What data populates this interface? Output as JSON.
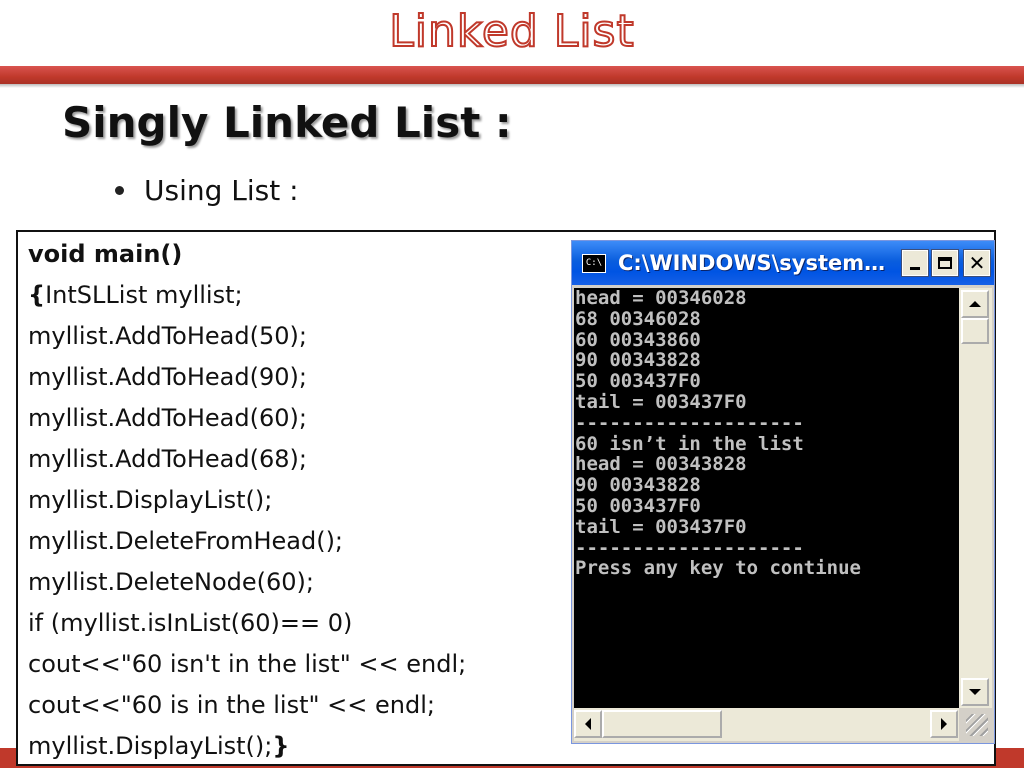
{
  "slide": {
    "title": "Linked List",
    "heading": "Singly Linked List :",
    "bullet": "Using List :"
  },
  "code": {
    "line1": "void main()",
    "line2_brace": "{",
    "line2_text": "IntSLList myllist;",
    "lines": [
      "myllist.AddToHead(50);",
      "myllist.AddToHead(90);",
      "myllist.AddToHead(60);",
      "myllist.AddToHead(68);",
      "myllist.DisplayList();",
      "myllist.DeleteFromHead();",
      "myllist.DeleteNode(60);",
      "if (myllist.isInList(60)== 0)",
      "cout<<\"60 isn't in the list\" << endl;",
      "cout<<\"60 is in the list\" << endl;"
    ],
    "last_text": "myllist.DisplayList();",
    "last_brace": "}"
  },
  "console": {
    "title": "C:\\WINDOWS\\system…",
    "icon_label": "C:\\",
    "output": [
      "head = 00346028",
      "68 00346028",
      "60 00343860",
      "90 00343828",
      "50 003437F0",
      "tail = 003437F0",
      "--------------------",
      "60 isn’t in the list",
      "head = 00343828",
      "90 00343828",
      "50 003437F0",
      "tail = 003437F0",
      "--------------------",
      "Press any key to continue"
    ]
  },
  "icons": {
    "console_icon": "cmd-window-icon",
    "minimize": "minimize-icon",
    "maximize": "maximize-icon",
    "close": "close-icon"
  },
  "colors": {
    "accent": "#c0392b",
    "titlebar": "#0054e3",
    "console_bg": "#000000",
    "console_text": "#c0c0c0"
  }
}
